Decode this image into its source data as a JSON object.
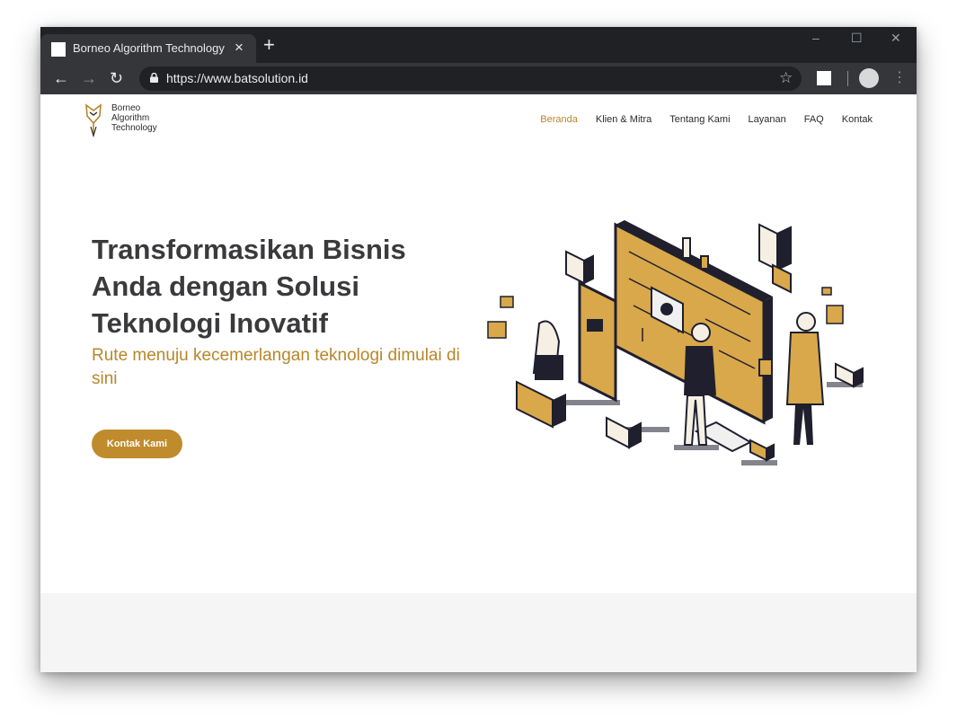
{
  "browser": {
    "tab_title": "Borneo Algorithm Technology",
    "tab_close": "×",
    "new_tab": "+",
    "url": "https://www.batsolution.id",
    "controls": {
      "minimize": "–",
      "maximize": "☐",
      "close": "✕"
    },
    "nav_icons": {
      "back": "←",
      "forward": "→",
      "reload": "↻",
      "bookmark": "☆",
      "menu": "⋮"
    }
  },
  "site": {
    "logo_lines": [
      "Borneo",
      "Algorithm",
      "Technology"
    ],
    "nav": [
      {
        "label": "Beranda",
        "active": true
      },
      {
        "label": "Klien & Mitra",
        "active": false
      },
      {
        "label": "Tentang Kami",
        "active": false
      },
      {
        "label": "Layanan",
        "active": false
      },
      {
        "label": "FAQ",
        "active": false
      },
      {
        "label": "Kontak",
        "active": false
      }
    ]
  },
  "hero": {
    "title_lines": [
      "Transformasikan Bisnis",
      "Anda dengan Solusi",
      "Teknologi Inovatif"
    ],
    "subtitle": "Rute menuju kecemerlangan teknologi dimulai di sini",
    "cta_label": "Kontak Kami"
  },
  "colors": {
    "accent": "#c08b2c",
    "accent_text": "#b8862a",
    "heading": "#3a3a3d",
    "chrome_dark": "#202124",
    "chrome_tab": "#35363a"
  }
}
